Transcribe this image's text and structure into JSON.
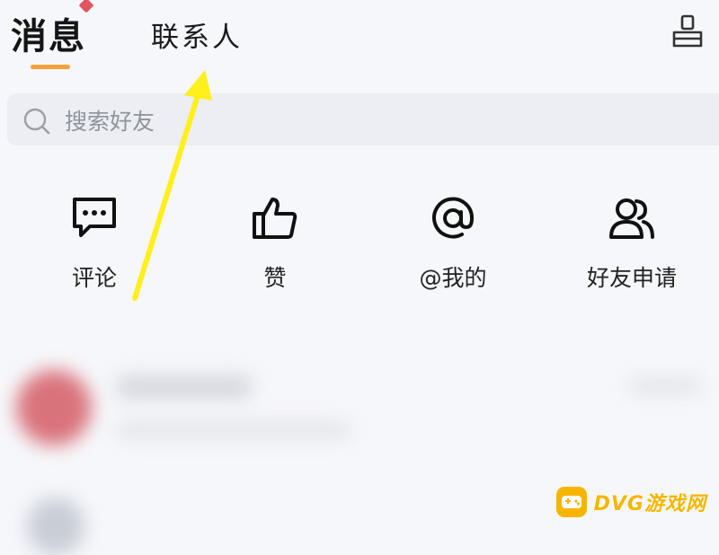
{
  "header": {
    "tabs": [
      {
        "label": "消息",
        "active": true
      },
      {
        "label": "联系人",
        "active": false
      }
    ],
    "accent_color": "#f2a33a",
    "badge_color": "#e05560",
    "right_icon": "clean-broom-icon"
  },
  "search": {
    "placeholder": "搜索好友",
    "icon": "search-icon"
  },
  "quick_actions": [
    {
      "label": "评论",
      "icon": "comment-bubble-icon"
    },
    {
      "label": "赞",
      "icon": "thumbs-up-icon"
    },
    {
      "label": "@我的",
      "icon": "at-sign-icon"
    },
    {
      "label": "好友申请",
      "icon": "friend-request-icon"
    }
  ],
  "annotation": {
    "color": "#ffef1a"
  },
  "watermark": {
    "text": "DVG游戏网",
    "color": "#f7b500"
  }
}
